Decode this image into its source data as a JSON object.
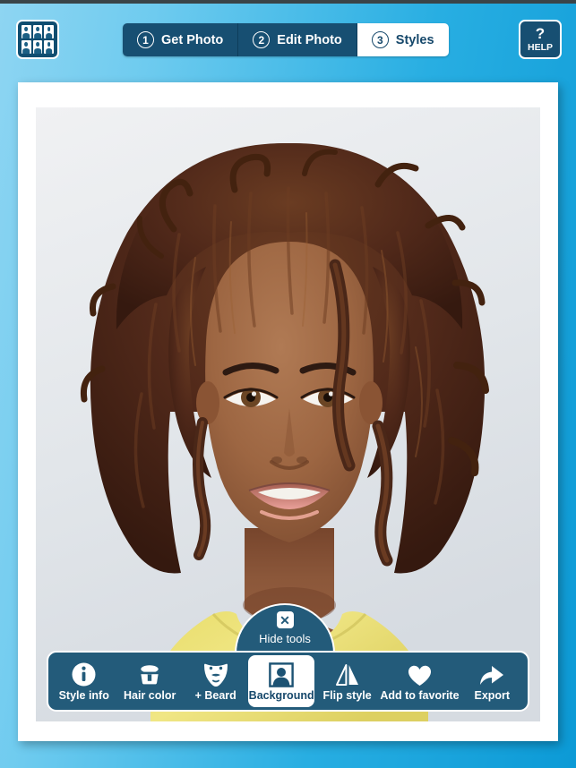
{
  "header": {
    "gallery_button_name": "gallery-grid-icon",
    "steps": [
      {
        "num": "1",
        "label": "Get Photo",
        "active": false
      },
      {
        "num": "2",
        "label": "Edit Photo",
        "active": false
      },
      {
        "num": "3",
        "label": "Styles",
        "active": true
      }
    ],
    "help": {
      "glyph": "?",
      "label": "HELP"
    }
  },
  "photo": {
    "alt": "Portrait of a smiling woman with natural curly twisted brown hair wearing a yellow tank top on a light gray background",
    "background_color": "#dfe3e8",
    "top_color": "#eef0f2",
    "shirt_color": "#ece06a",
    "skin_color": "#96593a",
    "hair_color": "#4e2a1c"
  },
  "hide_tools": {
    "label": "Hide tools",
    "close_glyph": "✕",
    "icon_name": "close-icon"
  },
  "toolbar": {
    "items": [
      {
        "label": "Style info",
        "icon": "info-circle-icon",
        "selected": false
      },
      {
        "label": "Hair color",
        "icon": "paint-bucket-icon",
        "selected": false
      },
      {
        "label": "+ Beard",
        "icon": "beard-icon",
        "selected": false
      },
      {
        "label": "Background",
        "icon": "portrait-frame-icon",
        "selected": true
      },
      {
        "label": "Flip style",
        "icon": "flip-mirror-icon",
        "selected": false
      },
      {
        "label": "Add to favorite",
        "icon": "heart-icon",
        "selected": false
      },
      {
        "label": "Export",
        "icon": "share-arrow-icon",
        "selected": false
      }
    ]
  },
  "colors": {
    "accent_dark": "#174f72",
    "toolbar_bg": "#235b7a",
    "bg_gradient_start": "#8ed5f2",
    "bg_gradient_end": "#0c9ad6"
  }
}
